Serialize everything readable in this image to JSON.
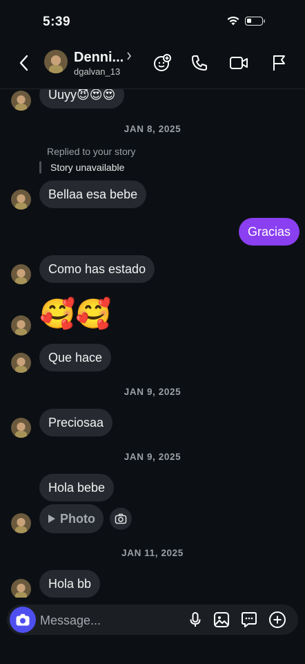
{
  "status": {
    "time": "5:39"
  },
  "header": {
    "name": "Denni...",
    "handle": "dgalvan_13"
  },
  "messages": {
    "m1": "Uuyy😈😍😍",
    "date1": "JAN 8, 2025",
    "replied": "Replied to your story",
    "story": "Story unavailable",
    "m2": "Bellaa esa bebe",
    "m3_out": "Gracias",
    "m4": "Como has estado",
    "m5_emoji": "🥰🥰",
    "m6": "Que hace",
    "date2": "JAN 9, 2025",
    "m7": "Preciosaa",
    "date3": "JAN 9, 2025",
    "m8": "Hola bebe",
    "photo_label": "Photo",
    "date4": "JAN 11, 2025",
    "m9": "Hola bb"
  },
  "composer": {
    "placeholder": "Message..."
  },
  "icons": [
    "back-icon",
    "chevron-right-icon",
    "add-sticker-icon",
    "phone-icon",
    "video-icon",
    "flag-icon",
    "camera-icon",
    "microphone-icon",
    "gallery-icon",
    "sticker-icon",
    "plus-icon"
  ],
  "colors": {
    "background": "#0c1014",
    "bubble_in": "#262a30",
    "bubble_out": "#8a3ff0",
    "camera_button": "#4f4ff0"
  }
}
